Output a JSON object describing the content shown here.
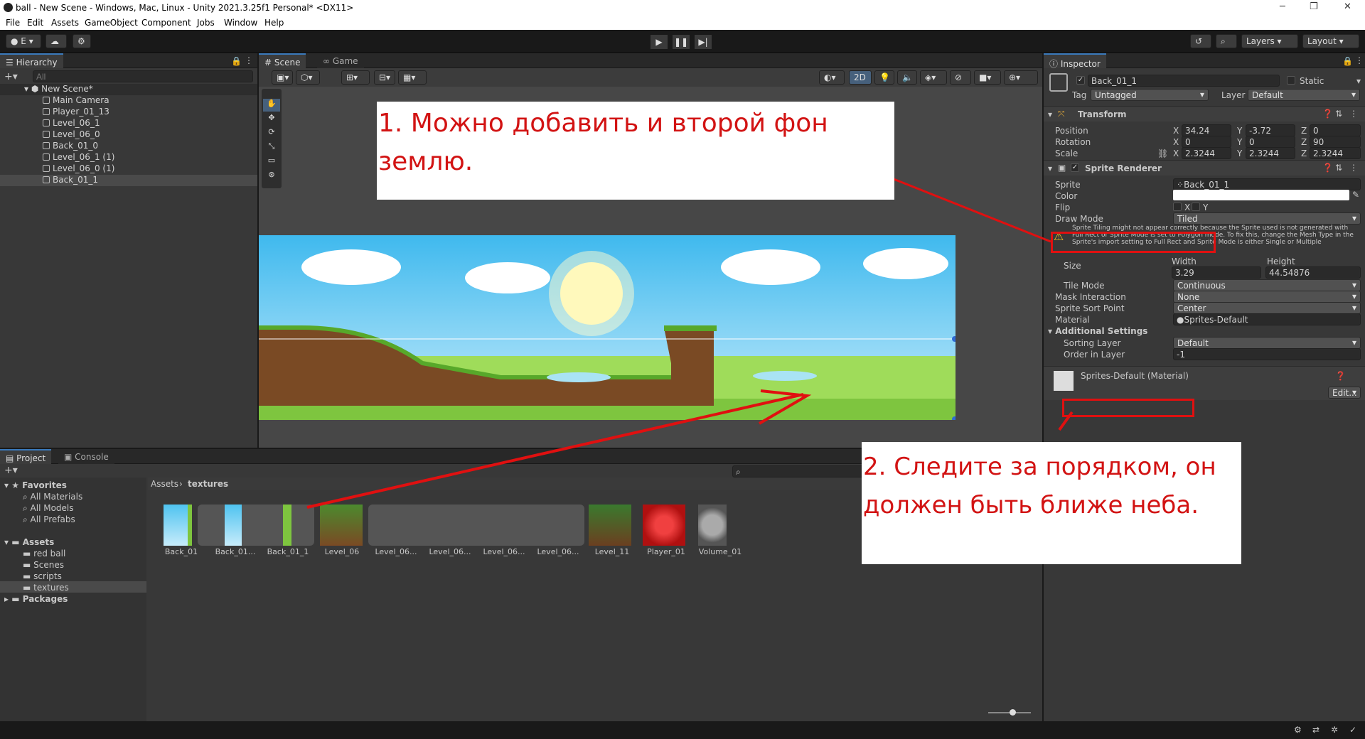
{
  "window": {
    "title": "ball - New Scene - Windows, Mac, Linux - Unity 2021.3.25f1 Personal* <DX11>",
    "minimize": "─",
    "maximize": "❐",
    "close": "✕"
  },
  "menu": [
    "File",
    "Edit",
    "Assets",
    "GameObject",
    "Component",
    "Jobs",
    "Window",
    "Help"
  ],
  "toolbar": {
    "account": "E",
    "layers": "Layers",
    "layout": "Layout"
  },
  "hierarchy": {
    "tab": "Hierarchy",
    "search_placeholder": "All",
    "scene": "New Scene*",
    "items": [
      "Main Camera",
      "Player_01_13",
      "Level_06_1",
      "Level_06_0",
      "Back_01_0",
      "Level_06_1 (1)",
      "Level_06_0 (1)",
      "Back_01_1"
    ]
  },
  "scene_tabs": {
    "scene": "Scene",
    "game": "Game",
    "mode2d": "2D"
  },
  "inspector": {
    "tab": "Inspector",
    "object_name": "Back_01_1",
    "static": "Static",
    "tag_label": "Tag",
    "tag": "Untagged",
    "layer_label": "Layer",
    "layer": "Default",
    "transform": {
      "title": "Transform",
      "position_label": "Position",
      "rotation_label": "Rotation",
      "scale_label": "Scale",
      "position": [
        "34.24",
        "-3.72",
        "0"
      ],
      "rotation": [
        "0",
        "0",
        "90"
      ],
      "scale": [
        "2.3244",
        "2.3244",
        "2.3244"
      ]
    },
    "sprite_renderer": {
      "title": "Sprite Renderer",
      "sprite_label": "Sprite",
      "sprite": "Back_01_1",
      "color_label": "Color",
      "flip_label": "Flip",
      "flip_x": "X",
      "flip_y": "Y",
      "draw_mode_label": "Draw Mode",
      "draw_mode": "Tiled",
      "warning": "Sprite Tiling might not appear correctly because the Sprite used is not generated with Full Rect or Sprite Mode is set to Polygon mode. To fix this, change the Mesh Type in the Sprite's import setting to Full Rect and Sprite Mode is either Single or Multiple",
      "size_label": "Size",
      "width_label": "Width",
      "height_label": "Height",
      "width": "3.29",
      "height": "44.54876",
      "tile_mode_label": "Tile Mode",
      "tile_mode": "Continuous",
      "mask_label": "Mask Interaction",
      "mask": "None",
      "sort_point_label": "Sprite Sort Point",
      "sort_point": "Center",
      "material_label": "Material",
      "material": "Sprites-Default",
      "additional": "Additional Settings",
      "sorting_layer_label": "Sorting Layer",
      "sorting_layer": "Default",
      "order_label": "Order in Layer",
      "order": "-1"
    },
    "material_section": "Sprites-Default (Material)",
    "edit": "Edit..."
  },
  "project": {
    "tab_project": "Project",
    "tab_console": "Console",
    "favorites": "Favorites",
    "fav_items": [
      "All Materials",
      "All Models",
      "All Prefabs"
    ],
    "assets": "Assets",
    "asset_folders": [
      "red ball",
      "Scenes",
      "scripts",
      "textures"
    ],
    "packages": "Packages",
    "breadcrumb_root": "Assets",
    "breadcrumb_leaf": "textures",
    "files": [
      "Back_01",
      "Back_01...",
      "Back_01_1",
      "Level_06",
      "Level_06...",
      "Level_06...",
      "Level_06...",
      "Level_06...",
      "Level_11",
      "Player_01",
      "Volume_01"
    ]
  },
  "annotations": {
    "note1_line1": "1. Можно добавить и второй фон",
    "note1_line2": "землю.",
    "note2_line1": "2. Следите за порядком, он",
    "note2_line2": "должен быть ближе неба."
  },
  "colors": {
    "accent": "#3a79bb",
    "annotation_red": "#d21313",
    "sky": "#4fc3f0",
    "grass": "#7ec53f"
  }
}
